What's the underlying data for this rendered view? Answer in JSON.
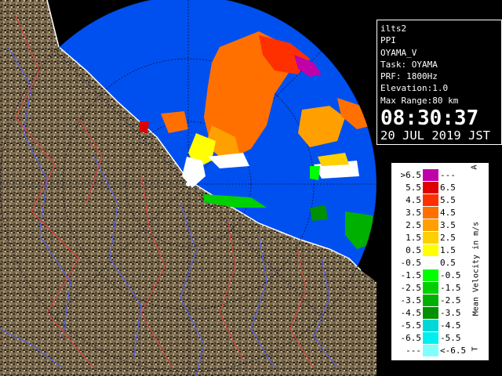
{
  "info": {
    "site": "ilts2",
    "product": "PPI",
    "radar": "OYAMA_V",
    "task": "Task: OYAMA",
    "prf": "PRF: 1800Hz",
    "elevation": "Elevation:1.0",
    "max_range": "Max Range:80 km",
    "time": "08:30:37",
    "date": "20 JUL 2019 JST"
  },
  "legend": {
    "title": "Mean Velocity in m/s",
    "top_mark": "A",
    "bottom_mark": "T",
    "rows": [
      {
        "lo": ">6.5",
        "hi": "---",
        "color": "#c000a8"
      },
      {
        "lo": "5.5",
        "hi": "6.5",
        "color": "#e00000"
      },
      {
        "lo": "4.5",
        "hi": "5.5",
        "color": "#ff3000"
      },
      {
        "lo": "3.5",
        "hi": "4.5",
        "color": "#ff7000"
      },
      {
        "lo": "2.5",
        "hi": "3.5",
        "color": "#ffa000"
      },
      {
        "lo": "1.5",
        "hi": "2.5",
        "color": "#ffd000"
      },
      {
        "lo": "0.5",
        "hi": "1.5",
        "color": "#ffff00"
      },
      {
        "lo": "-0.5",
        "hi": "0.5",
        "color": "#ffffff"
      },
      {
        "lo": "-1.5",
        "hi": "-0.5",
        "color": "#00ff00"
      },
      {
        "lo": "-2.5",
        "hi": "-1.5",
        "color": "#00d000"
      },
      {
        "lo": "-3.5",
        "hi": "-2.5",
        "color": "#00b000"
      },
      {
        "lo": "-4.5",
        "hi": "-3.5",
        "color": "#009000"
      },
      {
        "lo": "-5.5",
        "hi": "-4.5",
        "color": "#00d8d8"
      },
      {
        "lo": "-6.5",
        "hi": "-5.5",
        "color": "#00f0f0"
      },
      {
        "lo": "---",
        "hi": "<-6.5",
        "color": "#80ffff"
      }
    ]
  },
  "colors": {
    "sea": "#0050f0",
    "land": "#7a6a50",
    "background": "#000000"
  }
}
